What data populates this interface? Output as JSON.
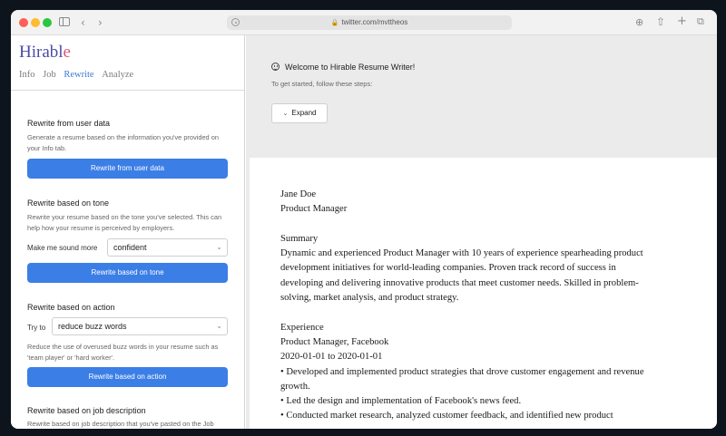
{
  "browser": {
    "url": "twitter.com/mvttheos"
  },
  "app": {
    "logo_main": "Hirabl",
    "logo_end": "e",
    "tabs": [
      "Info",
      "Job",
      "Rewrite",
      "Analyze"
    ],
    "active_tab": "Rewrite"
  },
  "sidebar": {
    "user_data": {
      "title": "Rewrite from user data",
      "desc": "Generate a resume based on the information you've provided on your Info tab.",
      "button": "Rewrite from user data"
    },
    "tone": {
      "title": "Rewrite based on tone",
      "desc": "Rewrite your resume based on the tone you've selected. This can help how your resume is perceived by employers.",
      "label": "Make me sound more",
      "selected": "confident",
      "button": "Rewrite based on tone"
    },
    "action": {
      "title": "Rewrite based on action",
      "label": "Try to",
      "selected": "reduce buzz words",
      "desc": "Reduce the use of overused buzz words in your resume such as 'team player' or 'hard worker'.",
      "button": "Rewrite based on action"
    },
    "job_desc": {
      "title": "Rewrite based on job description",
      "desc": "Rewrite based on job description that you've pasted on the Job Description tab. We will try to match your resume to"
    }
  },
  "welcome": {
    "title": "Welcome to Hirable Resume Writer!",
    "subtitle": "To get started, follow these steps:",
    "expand": "Expand"
  },
  "resume": {
    "name": "Jane Doe",
    "role": "Product Manager",
    "summary_heading": "Summary",
    "summary_lines": [
      "Dynamic and experienced Product Manager with 10 years of experience spearheading product",
      "development initiatives for world-leading companies. Proven track record of success in",
      "developing and delivering innovative products that meet customer needs. Skilled in problem-",
      "solving, market analysis, and product strategy."
    ],
    "experience_heading": "Experience",
    "job_title": "Product Manager, Facebook",
    "job_dates": "2020-01-01 to 2020-01-01",
    "bullet_lines": [
      "• Developed and implemented product strategies that drove customer engagement and revenue",
      "growth.",
      "• Led the design and implementation of Facebook's news feed.",
      "• Conducted market research, analyzed customer feedback, and identified new product"
    ]
  }
}
